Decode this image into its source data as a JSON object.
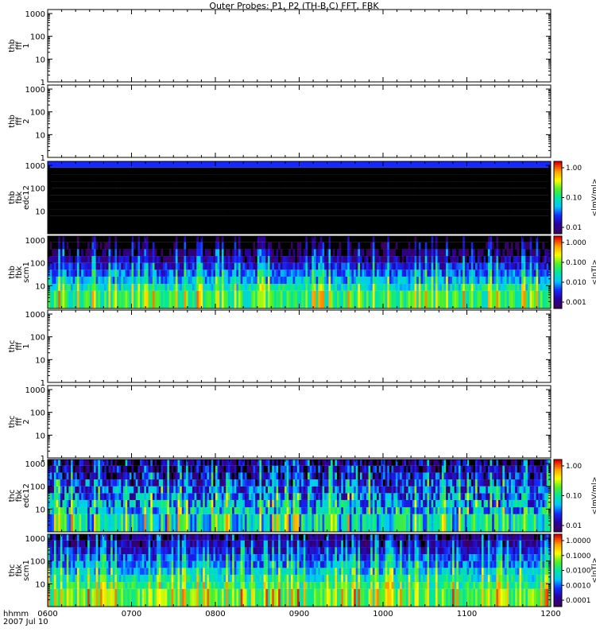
{
  "chart_data": {
    "type": "heatmap",
    "title": "Outer Probes: P1, P2 (TH-B,C) FFT, FBK",
    "x_tick_labels": [
      "0600",
      "0700",
      "0800",
      "0900",
      "1000",
      "1100",
      "1200"
    ],
    "x_label_lines": [
      "hhmm",
      "2007 Jul 10"
    ],
    "panels": [
      {
        "label": [
          "thb",
          "fff",
          "1"
        ],
        "y_ticks": [
          "1",
          "10",
          "100",
          "1000"
        ],
        "data": "none"
      },
      {
        "label": [
          "thb",
          "fff",
          "2"
        ],
        "y_ticks": [
          "1",
          "10",
          "100",
          "1000"
        ],
        "data": "none"
      },
      {
        "label": [
          "thb",
          "fbk",
          "edc12"
        ],
        "y_ticks": [
          "10",
          "100",
          "1000"
        ],
        "data": "spectrogram",
        "colorbar": {
          "label": "<|mV/m|>",
          "ticks": [
            "1.00",
            "0.10",
            "0.01"
          ]
        }
      },
      {
        "label": [
          "thb",
          "fbk",
          "scm1"
        ],
        "y_ticks": [
          "10",
          "100",
          "1000"
        ],
        "data": "spectrogram",
        "colorbar": {
          "label": "<|nT|>",
          "ticks": [
            "1.000",
            "0.100",
            "0.010",
            "0.001"
          ]
        }
      },
      {
        "label": [
          "thc",
          "fff",
          "1"
        ],
        "y_ticks": [
          "1",
          "10",
          "100",
          "1000"
        ],
        "data": "none"
      },
      {
        "label": [
          "thc",
          "fff",
          "2"
        ],
        "y_ticks": [
          "1",
          "10",
          "100",
          "1000"
        ],
        "data": "none"
      },
      {
        "label": [
          "thc",
          "fbk",
          "edc12"
        ],
        "y_ticks": [
          "10",
          "100",
          "1000"
        ],
        "data": "spectrogram",
        "colorbar": {
          "label": "<|mV/m|>",
          "ticks": [
            "1.00",
            "0.10",
            "0.01"
          ]
        }
      },
      {
        "label": [
          "thc",
          "fbk",
          "scm1"
        ],
        "y_ticks": [
          "10",
          "100",
          "1000"
        ],
        "data": "spectrogram",
        "colorbar": {
          "label": "<|nT|>",
          "ticks": [
            "1.0000",
            "0.1000",
            "0.0100",
            "0.0010",
            "0.0001"
          ]
        }
      }
    ]
  }
}
